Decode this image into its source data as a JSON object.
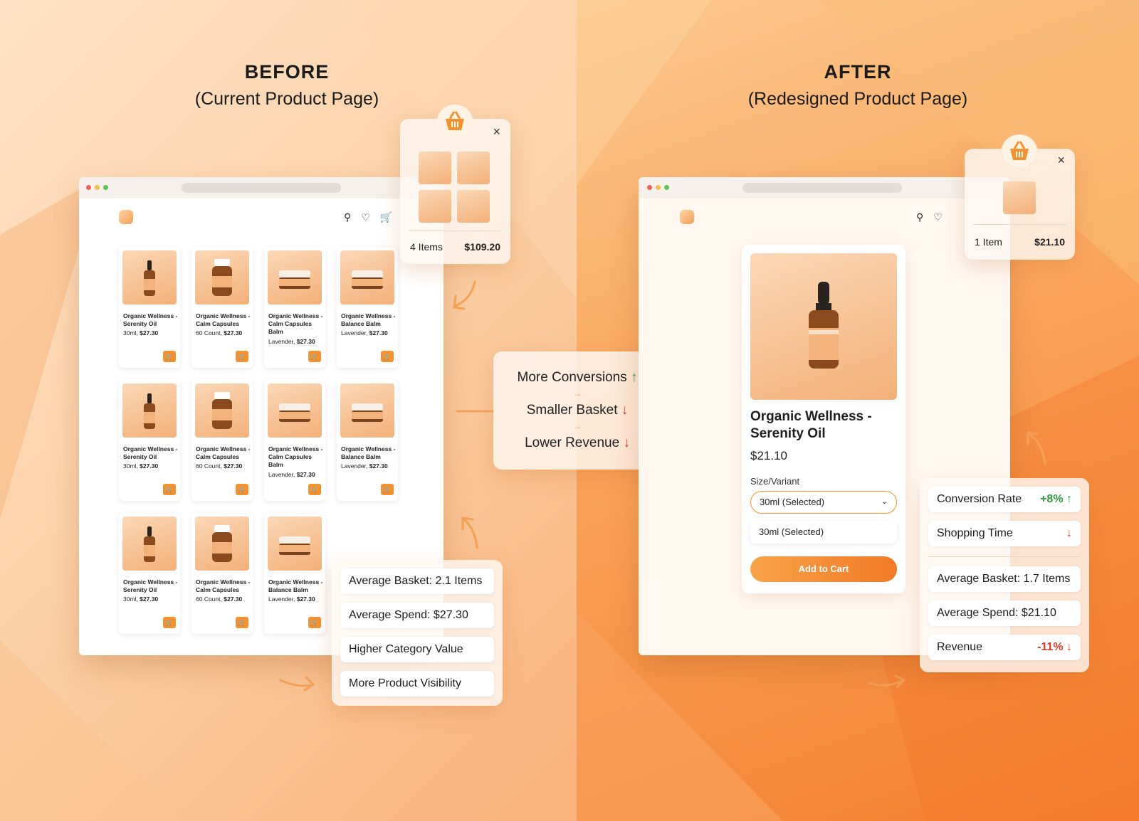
{
  "before": {
    "title": "BEFORE",
    "subtitle": "(Current Product Page)",
    "products": [
      {
        "name": "Organic Wellness - Serenity Oil",
        "variant": "30ml,",
        "price": "$27.30",
        "kind": "dropper"
      },
      {
        "name": "Organic Wellness - Calm Capsules",
        "variant": "60 Count,",
        "price": "$27.30",
        "kind": "jar"
      },
      {
        "name": "Organic Wellness - Calm Capsules Balm",
        "variant": "Lavender,",
        "price": "$27.30",
        "kind": "balm"
      },
      {
        "name": "Organic Wellness - Balance Balm",
        "variant": "Lavender,",
        "price": "$27.30",
        "kind": "balm"
      },
      {
        "name": "Organic Wellness - Serenity Oil",
        "variant": "30ml,",
        "price": "$27.30",
        "kind": "dropper"
      },
      {
        "name": "Organic Wellness - Calm Capsules",
        "variant": "60 Count,",
        "price": "$27.30",
        "kind": "jar"
      },
      {
        "name": "Organic Wellness - Calm Capsules Balm",
        "variant": "Lavender,",
        "price": "$27.30",
        "kind": "balm"
      },
      {
        "name": "Organic Wellness - Balance Balm",
        "variant": "Lavender,",
        "price": "$27.30",
        "kind": "balm"
      },
      {
        "name": "Organic Wellness - Serenity Oil",
        "variant": "30ml,",
        "price": "$27.30",
        "kind": "dropper"
      },
      {
        "name": "Organic Wellness - Calm Capsules",
        "variant": "60 Count,",
        "price": "$27.30",
        "kind": "jar"
      },
      {
        "name": "Organic Wellness - Balance Balm",
        "variant": "Lavender,",
        "price": "$27.30",
        "kind": "balm"
      }
    ],
    "cart_popup": {
      "items": "4 Items",
      "total": "$109.20",
      "close": "×"
    },
    "stats": [
      "Average Basket: 2.1 Items",
      "Average Spend: $27.30",
      "Higher Category Value",
      "More Product Visibility"
    ]
  },
  "middle": {
    "lines": [
      {
        "text": "More Conversions",
        "arrow": "↑",
        "color": "#2e9b3c"
      },
      {
        "text": "Smaller Basket",
        "arrow": "↓",
        "color": "#d83a2b"
      },
      {
        "text": "Lower Revenue",
        "arrow": "↓",
        "color": "#d83a2b"
      }
    ],
    "connector": "→"
  },
  "after": {
    "title": "AFTER",
    "subtitle": "(Redesigned Product Page)",
    "product": {
      "name_line1": "Organic Wellness -",
      "name_line2": "Serenity Oil",
      "price": "$21.10",
      "variant_label": "Size/Variant",
      "selected": "30ml (Selected)",
      "option": "30ml (Selected)",
      "add_to_cart": "Add to Cart"
    },
    "cart_popup": {
      "items": "1 Item",
      "total": "$21.10",
      "close": "×"
    },
    "stats_top": [
      {
        "label": "Conversion Rate",
        "value": "+8% ↑",
        "tone": "green"
      },
      {
        "label": "Shopping Time",
        "value": "↓",
        "tone": "red"
      }
    ],
    "stats_bottom": [
      {
        "label": "Average Basket: 1.7 Items",
        "value": "",
        "tone": ""
      },
      {
        "label": "Average Spend: $21.10",
        "value": "",
        "tone": ""
      },
      {
        "label": "Revenue",
        "value": "-11% ↓",
        "tone": "red"
      }
    ]
  },
  "colors": {
    "accent": "#f5922e",
    "green": "#2e9b3c",
    "red": "#d83a2b"
  }
}
